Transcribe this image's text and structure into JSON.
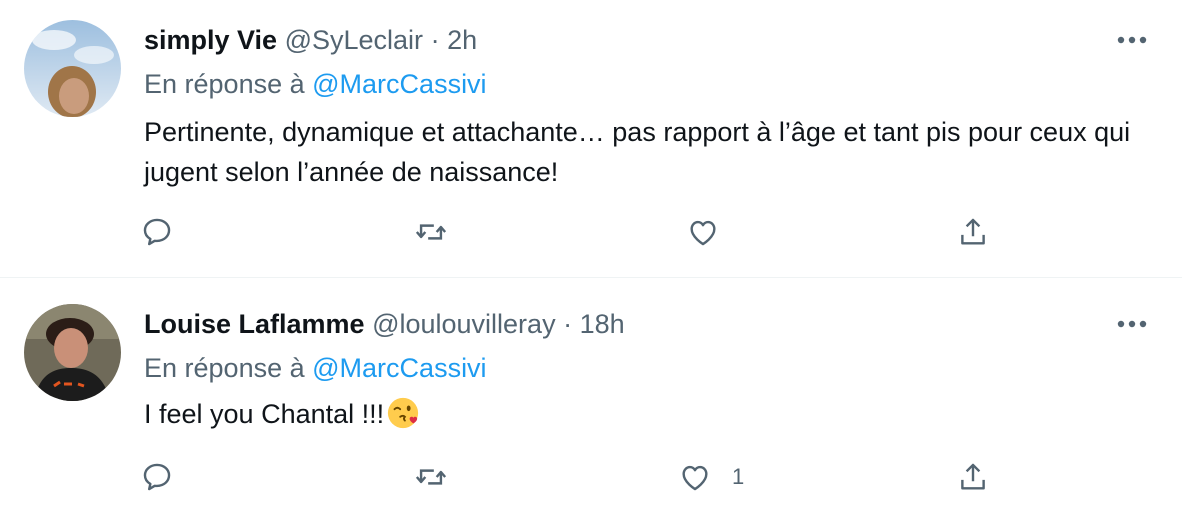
{
  "tweets": [
    {
      "name": "simply Vie",
      "handle": "@SyLeclair",
      "separator": "·",
      "time": "2h",
      "reply_prefix": "En réponse à",
      "reply_mention": "@MarcCassivi",
      "text": "Pertinente, dynamique et attachante… pas rapport à l’âge et tant pis pour ceux qui jugent selon l’année de naissance!",
      "like_count": ""
    },
    {
      "name": "Louise Laflamme",
      "handle": "@loulouvilleray",
      "separator": "·",
      "time": "18h",
      "reply_prefix": "En réponse à",
      "reply_mention": "@MarcCassivi",
      "text": "I feel you Chantal !!!",
      "emoji": "face-blowing-kiss",
      "like_count": "1"
    }
  ],
  "colors": {
    "text": "#0f1419",
    "secondary": "#536471",
    "accent": "#1d9bf0",
    "divider": "#eff3f4"
  },
  "icons": [
    "more-icon",
    "reply-icon",
    "retweet-icon",
    "like-icon",
    "share-icon"
  ]
}
